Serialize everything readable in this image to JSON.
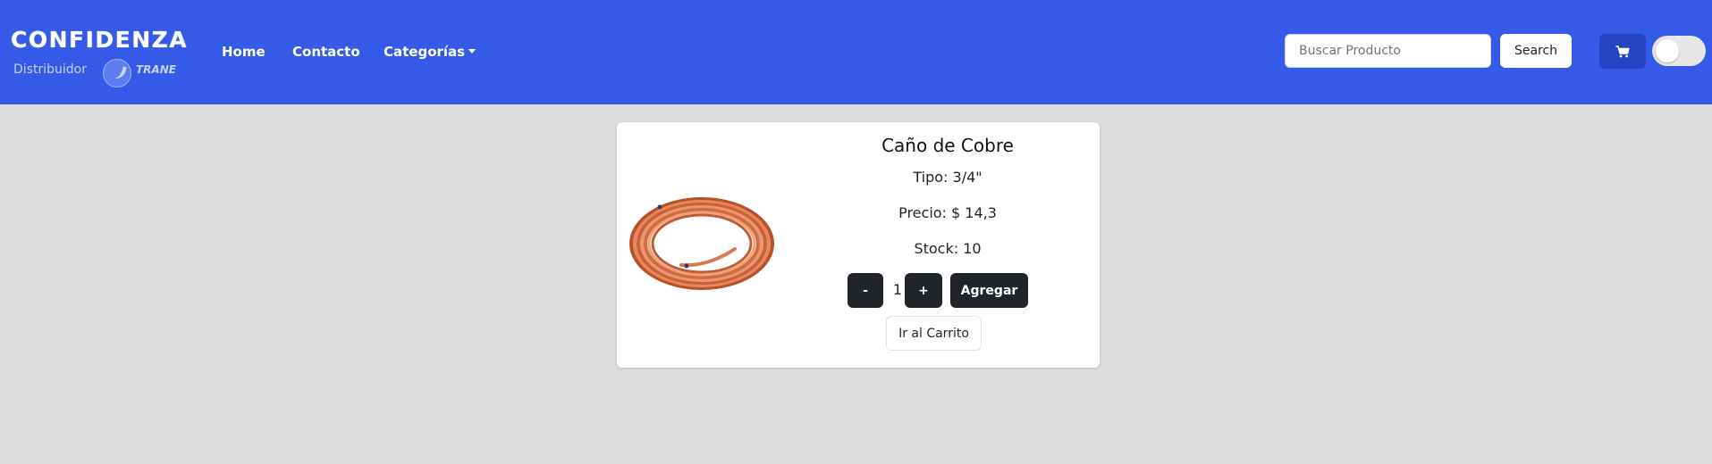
{
  "navbar": {
    "logo": {
      "top_text": "CONFIDENZA",
      "subtitle": "Distribuidor",
      "brand": "TRANE"
    },
    "links": [
      {
        "label": "Home"
      },
      {
        "label": "Contacto"
      },
      {
        "label": "Categorías"
      }
    ],
    "search": {
      "placeholder": "Buscar Producto",
      "value": "",
      "button_label": "Search"
    },
    "icons": {
      "cart": "shopping-cart-icon",
      "theme_toggle": "toggle-switch"
    },
    "theme_toggle_on": false,
    "colors": {
      "navbar_bg": "#355ae8",
      "cart_button_bg": "#2444c4"
    }
  },
  "product": {
    "title": "Caño de Cobre",
    "tipo_label": "Tipo: 3/4\"",
    "precio_label": "Precio: $ 14,3",
    "stock_label": "Stock: 10",
    "image": "copper-pipe-coil",
    "quantity": "1",
    "minus_label": "-",
    "plus_label": "+",
    "add_label": "Agregar",
    "go_cart_label": "Ir al Carrito"
  },
  "colors": {
    "page_bg": "#dcdcdc",
    "dark_button": "#212529"
  }
}
